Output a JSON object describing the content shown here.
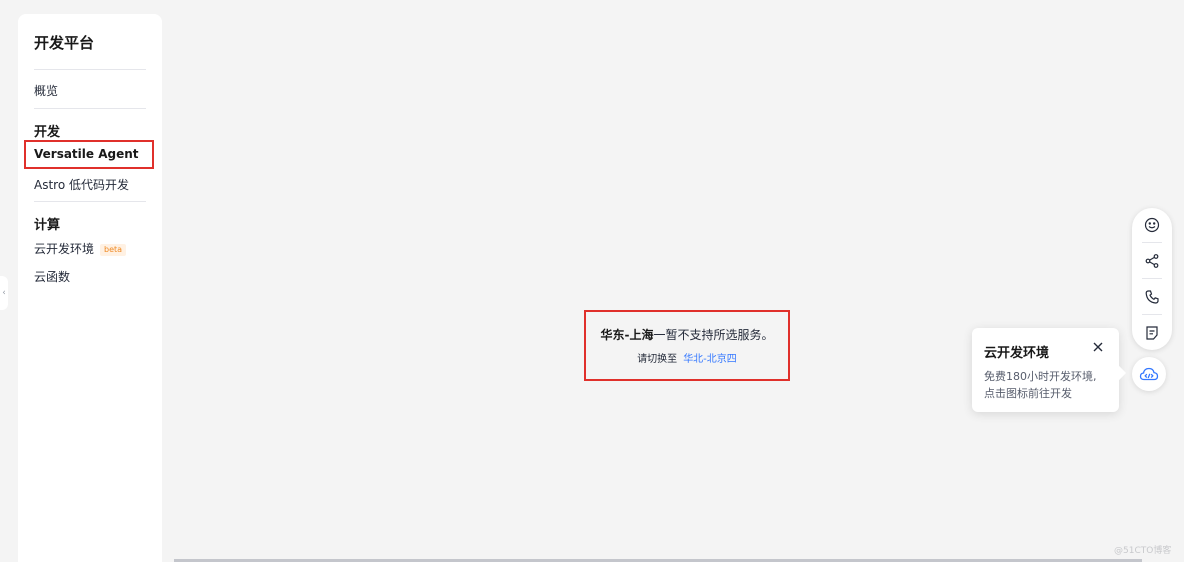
{
  "sidebar": {
    "title": "开发平台",
    "overview": "概览",
    "groups": [
      {
        "title": "开发",
        "items": [
          {
            "label": "Versatile Agent",
            "active": true
          },
          {
            "label": "Astro 低代码开发"
          }
        ]
      },
      {
        "title": "计算",
        "items": [
          {
            "label": "云开发环境",
            "badge": "beta"
          },
          {
            "label": "云函数"
          }
        ]
      }
    ]
  },
  "message": {
    "region": "华东-上海",
    "text": "一暂不支持所选服务。",
    "switch_prompt": "请切换至",
    "switch_link": "华北-北京四"
  },
  "float_toolbar": {
    "icons": [
      "smile-icon",
      "share-icon",
      "phone-icon",
      "feedback-icon"
    ],
    "cloud_icon": "cloud-code-icon"
  },
  "popover": {
    "title": "云开发环境",
    "line1": "免费180小时开发环境,",
    "line2": "点击图标前往开发"
  },
  "collapse_glyph": "‹",
  "watermark": "@51CTO博客",
  "colors": {
    "highlight": "#e0302b",
    "link": "#3377ff",
    "beta": "#f08a24"
  }
}
